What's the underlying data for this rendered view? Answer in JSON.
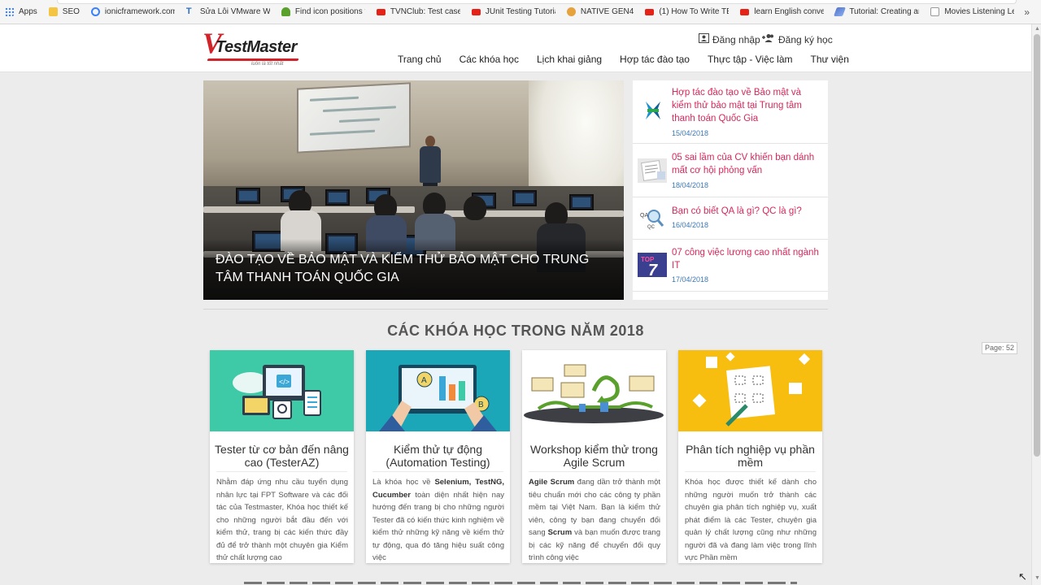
{
  "bookmarks": [
    {
      "label": "Apps",
      "icon": "apps-grid-icon",
      "color": "#4285f4"
    },
    {
      "label": "SEO",
      "icon": "folder-icon",
      "color": "#f4c542"
    },
    {
      "label": "ionicframework.com",
      "icon": "ionic-icon",
      "color": "#3880ff"
    },
    {
      "label": "Sửa Lỗi VMware Wo",
      "icon": "t-logo-icon",
      "color": "#2a72c9"
    },
    {
      "label": "Find icon positions f",
      "icon": "plant-icon",
      "color": "#5aa02c"
    },
    {
      "label": "TVNClub: Test case",
      "icon": "youtube-icon",
      "color": "#e62117"
    },
    {
      "label": "JUnit Testing Tutoria",
      "icon": "youtube-icon",
      "color": "#e62117"
    },
    {
      "label": "NATIVE GEN4",
      "icon": "orange-circle-icon",
      "color": "#e6a23c"
    },
    {
      "label": "(1) How To Write TE",
      "icon": "youtube-icon",
      "color": "#e62117"
    },
    {
      "label": "learn English conver",
      "icon": "youtube-icon",
      "color": "#e62117"
    },
    {
      "label": "Tutorial: Creating an",
      "icon": "feather-icon",
      "color": "#5577cc"
    },
    {
      "label": "Movies Listening Le",
      "icon": "page-icon",
      "color": "#999999"
    }
  ],
  "bookmarks_more": "»",
  "header": {
    "logo_text": "TestMaster",
    "logo_tagline": "luôn là tốt nhất",
    "login_label": "Đăng nhập",
    "register_label": "Đăng ký học",
    "nav": [
      "Trang chủ",
      "Các khóa học",
      "Lịch khai giảng",
      "Hợp tác đào tạo",
      "Thực tập - Việc làm",
      "Thư viện"
    ]
  },
  "hero": {
    "caption": "ĐÀO TẠO VỀ BẢO MẬT VÀ KIỂM THỬ BẢO MẬT CHO TRUNG TÂM THANH TOÁN QUỐC GIA"
  },
  "news": [
    {
      "title": "Hợp tác đào tạo về Bảo mật và kiểm thử bảo mật tại Trung tâm thanh toán Quốc Gia",
      "date": "15/04/2018",
      "icon": "napas-logo-icon"
    },
    {
      "title": "05 sai lầm của CV khiến bạn dánh mất cơ hội phỏng vấn",
      "date": "18/04/2018",
      "icon": "cv-document-icon"
    },
    {
      "title": "Bạn có biết QA là gì? QC là gì?",
      "date": "16/04/2018",
      "icon": "qa-qc-magnifier-icon"
    },
    {
      "title": "07 công việc lương cao nhất ngành IT",
      "date": "17/04/2018",
      "icon": "top7-icon"
    }
  ],
  "section_title": "CÁC KHÓA HỌC TRONG NĂM 2018",
  "page_badge": "Page: 52",
  "courses": [
    {
      "title": "Tester từ cơ bản đến nâng cao (TesterAZ)",
      "desc": "Nhằm đáp ứng nhu cầu tuyển dụng nhân lực tại FPT Software và các đối tác của Testmaster, Khóa học thiết kế cho những người bắt đầu đến với kiểm thử, trang bị các kiến thức đầy đủ để trở thành một chuyên gia Kiểm thử chất lượng cao",
      "bg": "#3ec9a7"
    },
    {
      "title": "Kiểm thử tự động (Automation Testing)",
      "desc_pre": "Là khóa học về ",
      "desc_bold1": "Selenium, TestNG, Cucumber",
      "desc_post": " toàn diện nhất hiện nay hướng đến trang bị cho những người Tester đã có kiến thức kinh nghiệm về kiểm thử những kỹ năng về kiểm thử tự động, qua đó tăng hiệu suất công việc",
      "bg": "#1ba7b8"
    },
    {
      "title": "Workshop kiểm thử trong Agile Scrum",
      "desc_bold1": "Agile Scrum",
      "desc_mid": " đang dần trở thành một tiêu chuẩn mới cho các công ty phần mềm tại Việt Nam. Bạn là kiểm thử viên, công ty bạn đang chuyển đổi sang ",
      "desc_bold2": "Scrum",
      "desc_post": " và bạn muốn được trang bị các kỹ năng để chuyển đổi quy trình công việc",
      "bg": "#ffffff"
    },
    {
      "title": "Phân tích nghiệp vụ phần mềm",
      "desc": "Khóa học được thiết kế dành cho những người muốn trở thành các chuyên gia phân tích nghiệp vụ, xuất phát điểm là các Tester, chuyên gia quản lý chất lượng cũng như những người đã và đang làm việc trong lĩnh vực Phần mềm",
      "bg": "#f7bd0f"
    }
  ],
  "colors": {
    "brand_red": "#d2232a",
    "news_title": "#d6285c",
    "news_date": "#3b77b5"
  }
}
